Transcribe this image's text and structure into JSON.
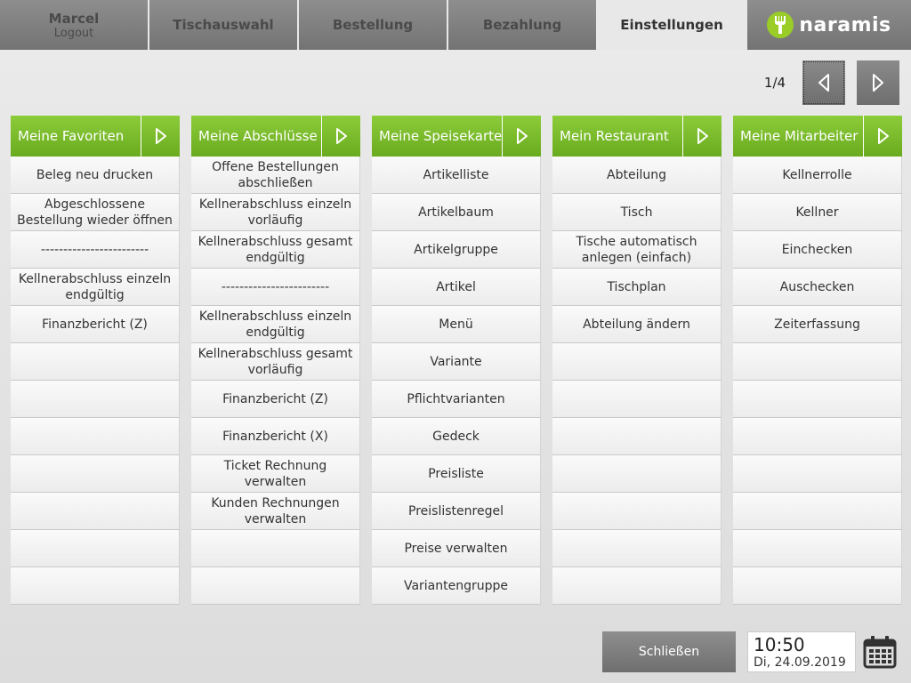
{
  "user": {
    "name": "Marcel",
    "logout": "Logout"
  },
  "nav": {
    "tabs": [
      {
        "label": "Tischauswahl"
      },
      {
        "label": "Bestellung"
      },
      {
        "label": "Bezahlung"
      },
      {
        "label": "Einstellungen"
      }
    ],
    "brand": "naramis"
  },
  "pager": {
    "label": "1/4"
  },
  "columns": [
    {
      "title": "Meine Favoriten",
      "items": [
        "Beleg neu drucken",
        "Abgeschlossene Bestellung wieder öffnen",
        "------------------------",
        "Kellnerabschluss einzeln endgültig",
        "Finanzbericht (Z)",
        "",
        "",
        "",
        "",
        "",
        "",
        ""
      ]
    },
    {
      "title": "Meine Abschlüsse",
      "items": [
        "Offene Bestellungen abschließen",
        "Kellnerabschluss einzeln vorläufig",
        "Kellnerabschluss gesamt endgültig",
        "------------------------",
        "Kellnerabschluss einzeln endgültig",
        "Kellnerabschluss gesamt vorläufig",
        "Finanzbericht (Z)",
        "Finanzbericht (X)",
        "Ticket Rechnung verwalten",
        "Kunden Rechnungen verwalten",
        "",
        ""
      ]
    },
    {
      "title": "Meine Speisekarte",
      "items": [
        "Artikelliste",
        "Artikelbaum",
        "Artikelgruppe",
        "Artikel",
        "Menü",
        "Variante",
        "Pflichtvarianten",
        "Gedeck",
        "Preisliste",
        "Preislistenregel",
        "Preise verwalten",
        "Variantengruppe"
      ]
    },
    {
      "title": "Mein Restaurant",
      "items": [
        "Abteilung",
        "Tisch",
        "Tische automatisch anlegen (einfach)",
        "Tischplan",
        "Abteilung ändern",
        "",
        "",
        "",
        "",
        "",
        "",
        ""
      ]
    },
    {
      "title": "Meine Mitarbeiter",
      "items": [
        "Kellnerrolle",
        "Kellner",
        "Einchecken",
        "Auschecken",
        "Zeiterfassung",
        "",
        "",
        "",
        "",
        "",
        "",
        ""
      ]
    }
  ],
  "footer": {
    "close_label": "Schließen",
    "time": "10:50",
    "date": "Di, 24.09.2019"
  },
  "colors": {
    "accent": "#7bbd2a",
    "nav": "#7f7f7f",
    "active_tab": "#e8e8e8"
  },
  "icons": {
    "brand": "fork-icon",
    "pager_prev": "triangle-left-icon",
    "pager_next": "triangle-right-icon",
    "column": "triangle-right-icon",
    "calendar": "calendar-icon"
  }
}
